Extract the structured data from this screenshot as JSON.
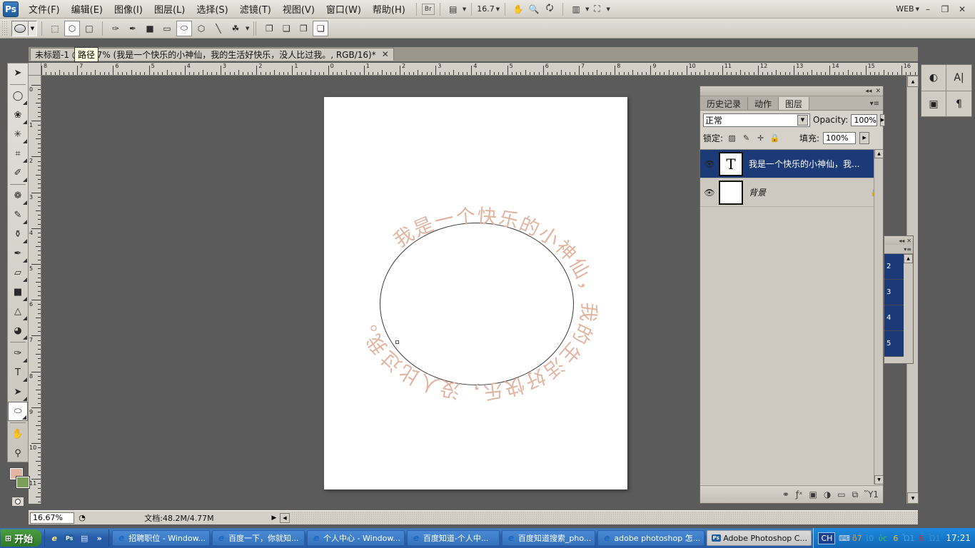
{
  "app": {
    "logo": "Ps",
    "zoom_display": "16.7",
    "web_label": "WEB",
    "minimize": "–",
    "restore": "❐",
    "close": "✕",
    "bridge_icon": "Br"
  },
  "menubar": {
    "items": [
      {
        "label": "文件(F)",
        "name": "menu-file"
      },
      {
        "label": "编辑(E)",
        "name": "menu-edit"
      },
      {
        "label": "图像(I)",
        "name": "menu-image"
      },
      {
        "label": "图层(L)",
        "name": "menu-layer"
      },
      {
        "label": "选择(S)",
        "name": "menu-select"
      },
      {
        "label": "滤镜(T)",
        "name": "menu-filter"
      },
      {
        "label": "视图(V)",
        "name": "menu-view"
      },
      {
        "label": "窗口(W)",
        "name": "menu-window"
      },
      {
        "label": "帮助(H)",
        "name": "menu-help"
      }
    ]
  },
  "document": {
    "tab_title": "未标题-1 @ 16.7% (我是一个快乐的小神仙，我的生活好快乐，没人比过我。, RGB/16)*",
    "close": "✕",
    "tooltip": "路径"
  },
  "statusbar": {
    "zoom": "16.67%",
    "doc_info": "文档:48.2M/4.77M",
    "triangle": "▶",
    "left_arrow": "◀"
  },
  "rulers": {
    "h_labels": [
      "8",
      "7",
      "6",
      "5",
      "4",
      "3",
      "2",
      "1",
      "0",
      "1",
      "2",
      "3",
      "4",
      "5",
      "6",
      "7",
      "8",
      "9",
      "10",
      "11",
      "12",
      "13",
      "14",
      "15",
      "16"
    ],
    "v_labels": [
      "0",
      "1",
      "2",
      "3",
      "4",
      "5",
      "6",
      "7",
      "8",
      "9",
      "10",
      "11"
    ]
  },
  "canvas": {
    "text_on_path": "我是一个快乐的小神仙，我的生活好快乐，没人比过我。",
    "text_color": "#e2b5a2",
    "path_color": "#3a3a3a",
    "paper_color": "#ffffff"
  },
  "toolbox": {
    "tools": [
      {
        "name": "move-tool",
        "glyph": "➤",
        "has_flyout": false
      },
      {
        "name": "elliptical-marquee-tool",
        "glyph": "◯",
        "has_flyout": true
      },
      {
        "name": "lasso-tool",
        "glyph": "❀",
        "has_flyout": true
      },
      {
        "name": "magic-wand-tool",
        "glyph": "✳",
        "has_flyout": true
      },
      {
        "name": "crop-tool",
        "glyph": "⌗",
        "has_flyout": true
      },
      {
        "name": "eyedropper-tool",
        "glyph": "✐",
        "has_flyout": true
      },
      {
        "name": "healing-brush-tool",
        "glyph": "❁",
        "has_flyout": true
      },
      {
        "name": "brush-tool",
        "glyph": "✎",
        "has_flyout": true
      },
      {
        "name": "clone-stamp-tool",
        "glyph": "⚱",
        "has_flyout": true
      },
      {
        "name": "history-brush-tool",
        "glyph": "✒",
        "has_flyout": true
      },
      {
        "name": "eraser-tool",
        "glyph": "▱",
        "has_flyout": true
      },
      {
        "name": "gradient-tool",
        "glyph": "■",
        "has_flyout": true
      },
      {
        "name": "blur-tool",
        "glyph": "△",
        "has_flyout": true
      },
      {
        "name": "dodge-tool",
        "glyph": "◕",
        "has_flyout": true
      },
      {
        "name": "pen-tool",
        "glyph": "✑",
        "has_flyout": true
      },
      {
        "name": "horizontal-type-tool",
        "glyph": "T",
        "has_flyout": true
      },
      {
        "name": "path-selection-tool",
        "glyph": "➤",
        "has_flyout": true
      },
      {
        "name": "ellipse-shape-tool",
        "glyph": "⬭",
        "has_flyout": true,
        "selected": true
      },
      {
        "name": "hand-tool",
        "glyph": "✋",
        "has_flyout": false
      },
      {
        "name": "zoom-tool",
        "glyph": "⚲",
        "has_flyout": false
      }
    ],
    "foreground_color": "#e2b5a2",
    "background_color": "#7c9e5a",
    "swap_icon": "⇄",
    "quickmask_icon": "▣"
  },
  "optionsbar": {
    "shape_preview": "ellipse-filled",
    "mode_buttons": [
      {
        "name": "shape-layers-button",
        "glyph": "⬚"
      },
      {
        "name": "paths-button",
        "glyph": "⬡",
        "selected": true
      },
      {
        "name": "fill-pixels-button",
        "glyph": "□"
      }
    ],
    "shape_tools": [
      {
        "name": "pen-tool-option",
        "glyph": "✑"
      },
      {
        "name": "freeform-pen-option",
        "glyph": "✒"
      },
      {
        "name": "rectangle-option",
        "glyph": "■"
      },
      {
        "name": "rounded-rectangle-option",
        "glyph": "▭"
      },
      {
        "name": "ellipse-option",
        "glyph": "⬭",
        "selected": true
      },
      {
        "name": "polygon-option",
        "glyph": "⬡"
      },
      {
        "name": "line-option",
        "glyph": "╲"
      },
      {
        "name": "custom-shape-option",
        "glyph": "☘"
      }
    ],
    "path_ops": [
      {
        "name": "add-to-path-area",
        "glyph": "❐"
      },
      {
        "name": "subtract-from-path-area",
        "glyph": "❑"
      },
      {
        "name": "intersect-path-areas",
        "glyph": "❒"
      },
      {
        "name": "exclude-overlapping-areas",
        "glyph": "❏",
        "selected": true
      }
    ]
  },
  "layers_panel": {
    "tabs": [
      {
        "label": "历史记录",
        "name": "tab-history",
        "active": false
      },
      {
        "label": "动作",
        "name": "tab-actions",
        "active": false
      },
      {
        "label": "图层",
        "name": "tab-layers",
        "active": true
      }
    ],
    "menu_glyph": "▾≡",
    "collapse_glyph": "◂◂",
    "close_glyph": "✕",
    "blend_mode": "正常",
    "opacity_label": "Opacity:",
    "opacity_value": "100%",
    "lock_label": "锁定:",
    "fill_label": "填充:",
    "fill_value": "100%",
    "lock_icons": [
      {
        "name": "lock-transparent-pixels-icon",
        "glyph": "▨"
      },
      {
        "name": "lock-image-pixels-icon",
        "glyph": "✐"
      },
      {
        "name": "lock-position-icon",
        "glyph": "✛"
      },
      {
        "name": "lock-all-icon",
        "glyph": "ὑ2"
      }
    ],
    "layers": [
      {
        "name": "我是一个快乐的小神仙，我...",
        "thumb": "T",
        "type": "text",
        "visible": true,
        "selected": true,
        "locked": false
      },
      {
        "name": "背景",
        "thumb": "",
        "type": "background",
        "visible": true,
        "selected": false,
        "locked": true,
        "lock_glyph": "ὑ2"
      }
    ],
    "bottom_buttons": [
      {
        "name": "link-layers-button",
        "glyph": "⚭"
      },
      {
        "name": "layer-style-button",
        "glyph": "ƒˣ"
      },
      {
        "name": "add-layer-mask-button",
        "glyph": "▣"
      },
      {
        "name": "new-fill-adjustment-button",
        "glyph": "◑"
      },
      {
        "name": "new-group-button",
        "glyph": "▭"
      },
      {
        "name": "new-layer-button",
        "glyph": "⧉"
      },
      {
        "name": "delete-layer-button",
        "glyph": "Ὕ1"
      }
    ]
  },
  "dock_right": {
    "icons": [
      {
        "name": "color-adjustment-icon",
        "glyph": "◐"
      },
      {
        "name": "layer-mask-icon",
        "glyph": "▣"
      },
      {
        "name": "character-panel-icon",
        "glyph": "A|"
      },
      {
        "name": "paragraph-panel-icon",
        "glyph": "¶"
      }
    ]
  },
  "dock_side": {
    "collapse_glyph": "◂◂",
    "close_glyph": "✕",
    "menu_glyph": "▾≡",
    "rows": [
      "2",
      "3",
      "4",
      "5"
    ]
  },
  "taskbar": {
    "start_label": "开始",
    "quick_launch": [
      {
        "name": "quicklaunch-ie-icon",
        "glyph": "e"
      },
      {
        "name": "quicklaunch-photoshop-icon",
        "glyph": "Ps"
      },
      {
        "name": "quicklaunch-showdesktop-icon",
        "glyph": "Ὓ5"
      },
      {
        "name": "quicklaunch-overflow-icon",
        "glyph": "»"
      }
    ],
    "tasks": [
      {
        "label": "招聘职位 - Window...",
        "icon": "e",
        "active": false,
        "name": "taskbar-item-zhaopin"
      },
      {
        "label": "百度一下，你就知...",
        "icon": "e",
        "active": false,
        "name": "taskbar-item-baidu"
      },
      {
        "label": "个人中心 - Window...",
        "icon": "e",
        "active": false,
        "name": "taskbar-item-gerenzhongxin"
      },
      {
        "label": "百度知道-个人中...",
        "icon": "e",
        "active": false,
        "name": "taskbar-item-baiduzhidao"
      },
      {
        "label": "百度知道搜索_pho...",
        "icon": "e",
        "active": false,
        "name": "taskbar-item-baidusousuo"
      },
      {
        "label": "adobe photoshop 怎...",
        "icon": "e",
        "active": false,
        "name": "taskbar-item-adobe-query"
      },
      {
        "label": "Adobe Photoshop C...",
        "icon": "Ps",
        "active": true,
        "name": "taskbar-item-photoshop"
      }
    ],
    "ime": "CH",
    "tray_icons": [
      {
        "name": "keyboard-icon",
        "glyph": "⌨"
      },
      {
        "name": "qq-penguin-icon",
        "glyph": "ὂ7"
      },
      {
        "name": "network-globe-icon",
        "glyph": "ἱ0"
      },
      {
        "name": "usb-safely-remove-icon",
        "glyph": "ὐc"
      },
      {
        "name": "signal-warning-icon",
        "glyph": "὏6"
      },
      {
        "name": "antivirus-shield-icon",
        "glyph": "Ὦ1"
      },
      {
        "name": "signal-error-icon",
        "glyph": "὏6"
      },
      {
        "name": "security-center-icon",
        "glyph": "Ὦ1"
      }
    ],
    "clock": "17:21"
  }
}
